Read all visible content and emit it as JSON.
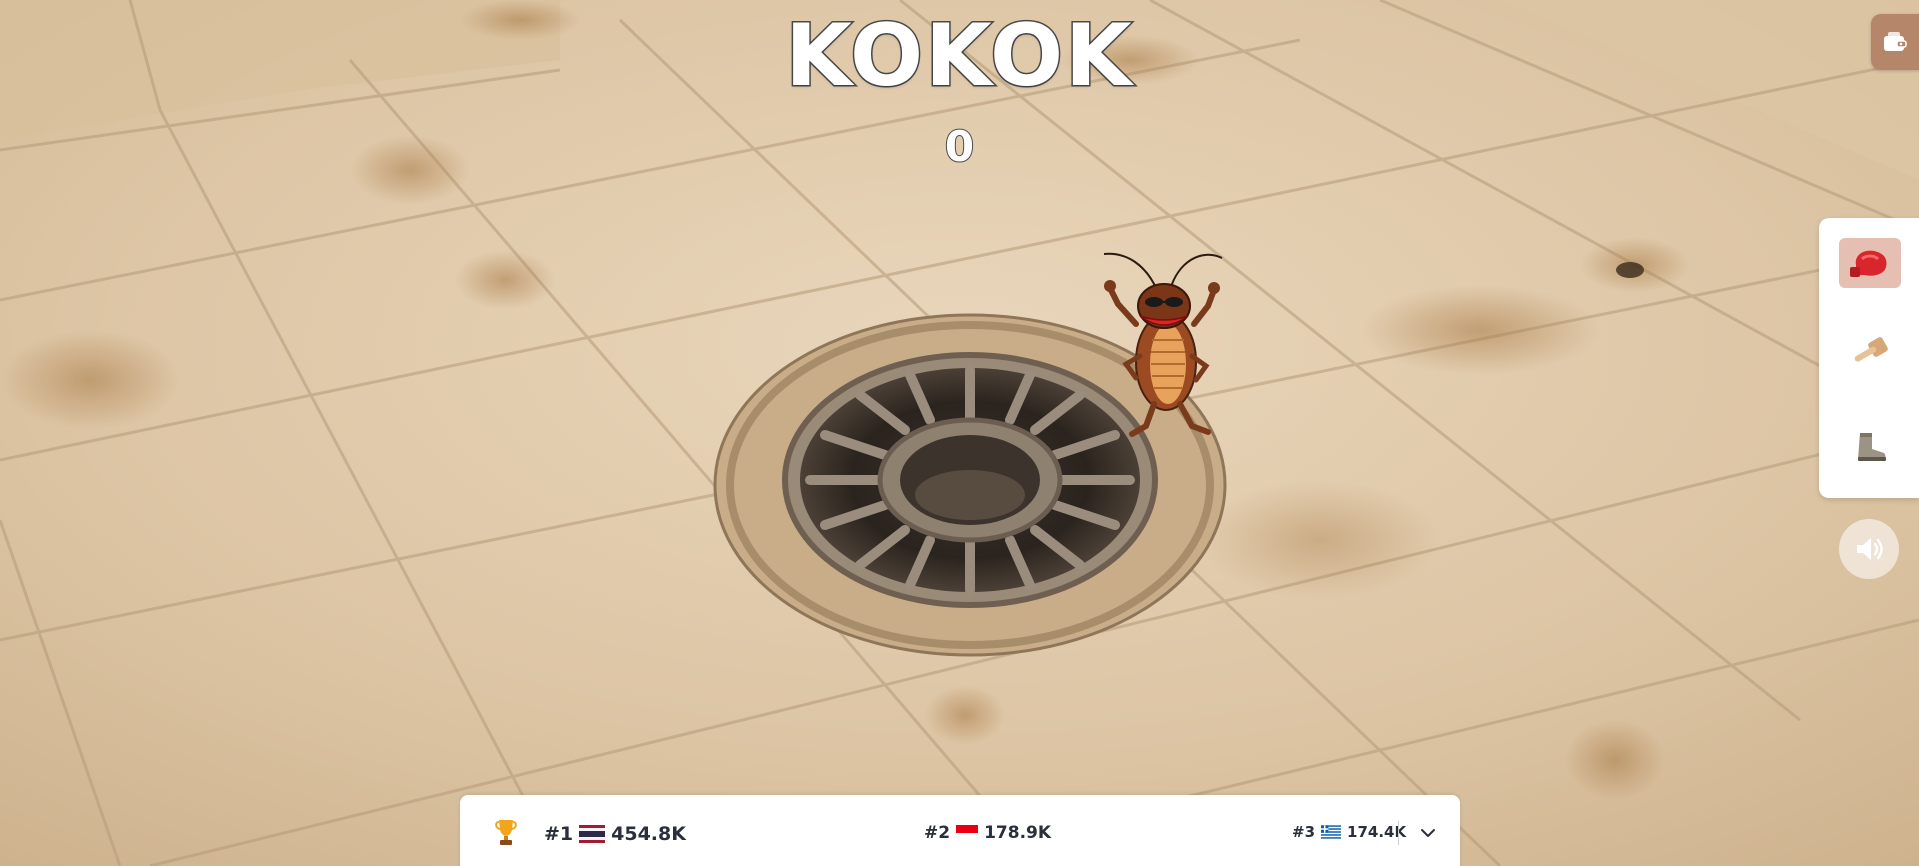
{
  "game": {
    "title": "KOKOK",
    "score": "0"
  },
  "toolbar": {
    "wallet_icon": "wallet-icon",
    "sound_icon": "speaker-icon"
  },
  "weapons": [
    {
      "name": "boxing-glove",
      "icon": "boxing-glove-icon",
      "selected": true
    },
    {
      "name": "hammer",
      "icon": "hammer-icon",
      "selected": false
    },
    {
      "name": "boot",
      "icon": "boot-icon",
      "selected": false
    }
  ],
  "leaderboard": {
    "entries": [
      {
        "rank": "#1",
        "flag": "thailand-flag-icon",
        "score": "454.8K"
      },
      {
        "rank": "#2",
        "flag": "indonesia-flag-icon",
        "score": "178.9K"
      },
      {
        "rank": "#3",
        "flag": "greece-flag-icon",
        "score": "174.4K"
      }
    ]
  },
  "colors": {
    "accent": "#b5866a",
    "selected_weapon_bg": "#e6bfb3",
    "text_dark": "#2a2f3b"
  }
}
